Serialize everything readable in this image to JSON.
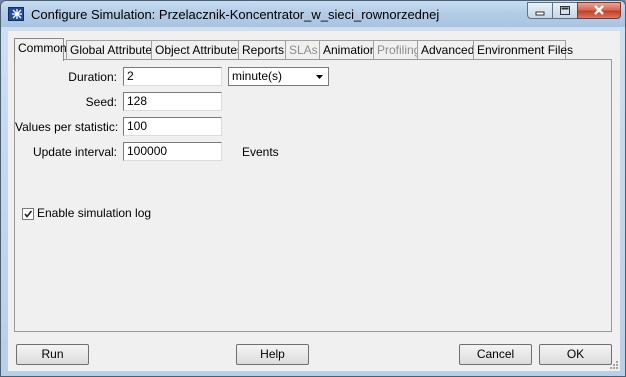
{
  "window": {
    "title": "Configure Simulation: Przelacznik-Koncentrator_w_sieci_rownorzednej"
  },
  "tabs": [
    {
      "label": "Common",
      "state": "active"
    },
    {
      "label": "Global Attributes",
      "state": "normal"
    },
    {
      "label": "Object Attributes",
      "state": "normal"
    },
    {
      "label": "Reports",
      "state": "normal"
    },
    {
      "label": "SLAs",
      "state": "disabled"
    },
    {
      "label": "Animation",
      "state": "normal"
    },
    {
      "label": "Profiling",
      "state": "disabled"
    },
    {
      "label": "Advanced",
      "state": "normal"
    },
    {
      "label": "Environment Files",
      "state": "normal"
    }
  ],
  "common": {
    "duration": {
      "label": "Duration:",
      "value": "2",
      "unit": "minute(s)"
    },
    "seed": {
      "label": "Seed:",
      "value": "128"
    },
    "values_per_statistic": {
      "label": "Values per statistic:",
      "value": "100"
    },
    "update_interval": {
      "label": "Update interval:",
      "value": "100000",
      "unit": "Events"
    },
    "enable_log": {
      "label": "Enable simulation log",
      "checked": true
    }
  },
  "buttons": {
    "run": {
      "first": "R",
      "rest": "un"
    },
    "help": {
      "first": "H",
      "rest": "elp"
    },
    "cancel": {
      "first": "C",
      "rest": "ancel"
    },
    "ok": {
      "first": "O",
      "rest": "K"
    }
  },
  "icons": {
    "app": "simulation-app-icon",
    "minimize": "minimize-icon",
    "maximize": "maximize-icon",
    "close": "close-icon",
    "dropdown": "chevron-down-icon",
    "check": "checkmark-icon",
    "grip": "resize-grip-icon"
  },
  "colors": {
    "titlebar": "#b2cbe6",
    "close_button": "#c2402a",
    "client": "#f0f0f0"
  }
}
